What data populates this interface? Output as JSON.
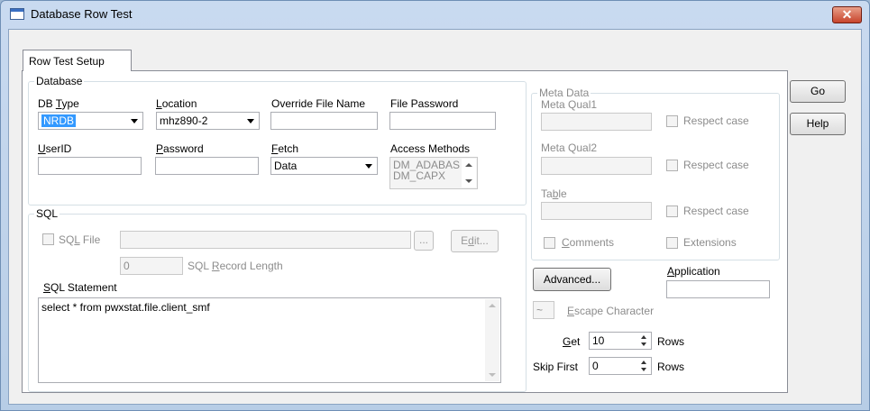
{
  "window": {
    "title": "Database Row Test",
    "close_glyph": "✕"
  },
  "tab": {
    "label": "Row Test Setup"
  },
  "side_buttons": {
    "go": "Go",
    "help": "Help"
  },
  "database": {
    "legend": "Database",
    "db_type": {
      "label": "DB Type",
      "value": "NRDB"
    },
    "location": {
      "label": "Location",
      "value": "mhz890-2"
    },
    "override_file_name": {
      "label": "Override File Name",
      "value": ""
    },
    "file_password": {
      "label": "File Password",
      "value": ""
    },
    "userid": {
      "label": "UserID",
      "value": ""
    },
    "password": {
      "label": "Password",
      "value": ""
    },
    "fetch": {
      "label": "Fetch",
      "value": "Data"
    },
    "access_methods": {
      "label": "Access Methods",
      "items": [
        "DM_ADABAS",
        "DM_CAPX"
      ]
    }
  },
  "sql": {
    "legend": "SQL",
    "sql_file": {
      "label": "SQL File",
      "value": "",
      "browse": "...",
      "edit": "Edit..."
    },
    "record_length": {
      "value": "0",
      "label": "SQL Record Length"
    },
    "statement": {
      "label": "SQL Statement",
      "value": "select * from pwxstat.file.client_smf"
    }
  },
  "meta": {
    "legend": "Meta Data",
    "qual1": {
      "label": "Meta Qual1",
      "respect": "Respect case"
    },
    "qual2": {
      "label": "Meta Qual2",
      "respect": "Respect case"
    },
    "table": {
      "label": "Table",
      "respect": "Respect case"
    },
    "comments": "Comments",
    "extensions": "Extensions"
  },
  "advanced_button": "Advanced...",
  "application": {
    "label": "Application",
    "value": ""
  },
  "escape": {
    "value": "~",
    "label": "Escape Character"
  },
  "get": {
    "label": "Get",
    "value": "10",
    "unit": "Rows"
  },
  "skip_first": {
    "label": "Skip First",
    "value": "0",
    "unit": "Rows"
  }
}
